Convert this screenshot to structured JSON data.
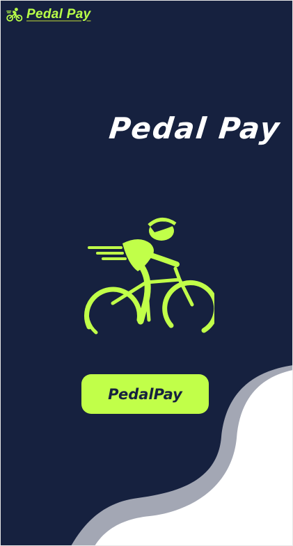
{
  "header": {
    "brand": "Pedal Pay",
    "logo_icon": "cyclist-icon"
  },
  "hero": {
    "title": "Pedal Pay",
    "illustration_icon": "cyclist-icon"
  },
  "cta": {
    "label": "PedalPay"
  },
  "colors": {
    "background": "#16213f",
    "accent": "#c1ff49",
    "wave_gray": "#a3a7b4",
    "wave_white": "#ffffff"
  }
}
